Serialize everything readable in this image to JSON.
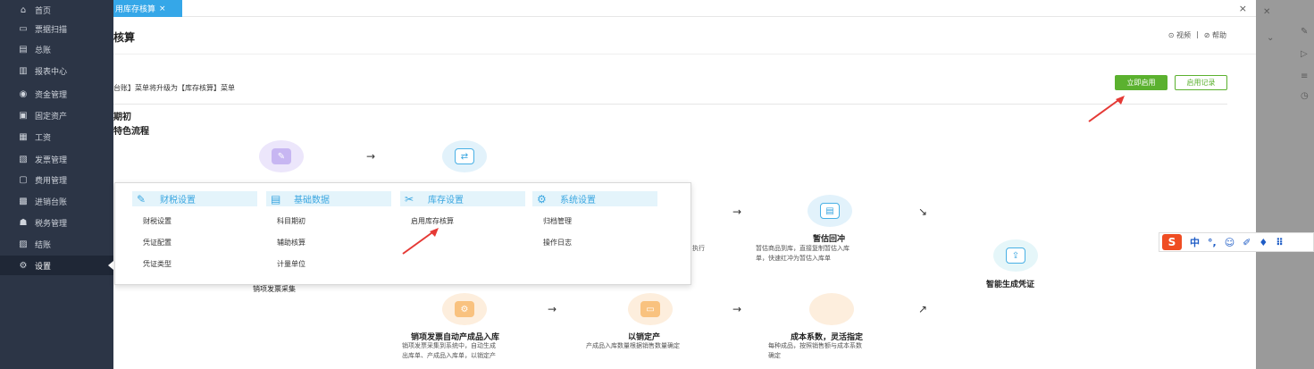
{
  "sidebar": {
    "items": [
      {
        "icon": "home-icon",
        "glyph": "⌂",
        "label": "首页"
      },
      {
        "icon": "scan-icon",
        "glyph": "▭",
        "label": "票据扫描"
      },
      {
        "icon": "ledger-icon",
        "glyph": "▤",
        "label": "总账"
      },
      {
        "icon": "report-icon",
        "glyph": "▥",
        "label": "报表中心"
      },
      {
        "icon": "funds-icon",
        "glyph": "◉",
        "label": "资金管理"
      },
      {
        "icon": "asset-icon",
        "glyph": "▣",
        "label": "固定资产"
      },
      {
        "icon": "salary-icon",
        "glyph": "▦",
        "label": "工资"
      },
      {
        "icon": "invoice-icon",
        "glyph": "▧",
        "label": "发票管理"
      },
      {
        "icon": "expense-icon",
        "glyph": "▢",
        "label": "费用管理"
      },
      {
        "icon": "inventory-icon",
        "glyph": "▩",
        "label": "进销台账"
      },
      {
        "icon": "tax-icon",
        "glyph": "☗",
        "label": "税务管理"
      },
      {
        "icon": "closing-icon",
        "glyph": "▨",
        "label": "结账"
      },
      {
        "icon": "settings-icon",
        "glyph": "⚙",
        "label": "设置"
      }
    ]
  },
  "tabs": {
    "active_label": "用库存核算",
    "close_glyph": "×",
    "window_close": "×"
  },
  "header": {
    "title": "核算",
    "video_link": "⊙ 视频",
    "separator": "|",
    "help_link": "⊘ 帮助"
  },
  "notice": {
    "text": "台账】菜单将升级为【库存核算】菜单",
    "start_button": "立即启用",
    "record_button": "启用记录"
  },
  "sections": {
    "s1": "期初",
    "s2": "特色流程"
  },
  "flow": {
    "arrow1": "→",
    "arrow2": "→",
    "arrow3": "↘",
    "arrow4": "→",
    "arrow5": "→",
    "arrow6": "↗",
    "step_estimate_title": "暂估回冲",
    "step_estimate_desc1": "暂估商品到库，直接复制暂估入库",
    "step_estimate_desc2": "单，快速红冲为暂估入库单",
    "step_exec_fragment": "执行",
    "step_sales_fragment": "销项发票采集",
    "step_voucher_title": "智能生成凭证",
    "step_auto_title": "销项发票自动产成品入库",
    "step_auto_desc1": "销项发票采集到系统中，自动生成",
    "step_auto_desc2": "出库单、产成品入库单，以销定产",
    "step_sale_title": "以销定产",
    "step_sale_desc1": "产成品入库数量根据销售数量确定",
    "step_cost_title": "成本系数，灵活指定",
    "step_cost_desc1": "每种成品，按照销售额与成本系数",
    "step_cost_desc2": "确定"
  },
  "popup": {
    "groups": [
      {
        "icon": "tax-settings-icon",
        "glyph": "✎",
        "title": "财税设置",
        "items": [
          "财税设置",
          "凭证配置",
          "凭证类型"
        ]
      },
      {
        "icon": "basic-data-icon",
        "glyph": "▤",
        "title": "基础数据",
        "items": [
          "科目期初",
          "辅助核算",
          "计量单位"
        ]
      },
      {
        "icon": "inventory-settings-icon",
        "glyph": "✂",
        "title": "库存设置",
        "items": [
          "启用库存核算"
        ]
      },
      {
        "icon": "system-settings-icon",
        "glyph": "⚙",
        "title": "系统设置",
        "items": [
          "归档管理",
          "操作日志"
        ]
      }
    ]
  },
  "ime": {
    "logo": "S",
    "items": [
      "中",
      "°,",
      "☺",
      "✐",
      "♦",
      "⠿"
    ]
  },
  "colors": {
    "sidebar_bg": "#2c3546",
    "tab_active": "#35a7e8",
    "primary_green": "#5bb12f",
    "menu_blue": "#3aa6e0"
  }
}
